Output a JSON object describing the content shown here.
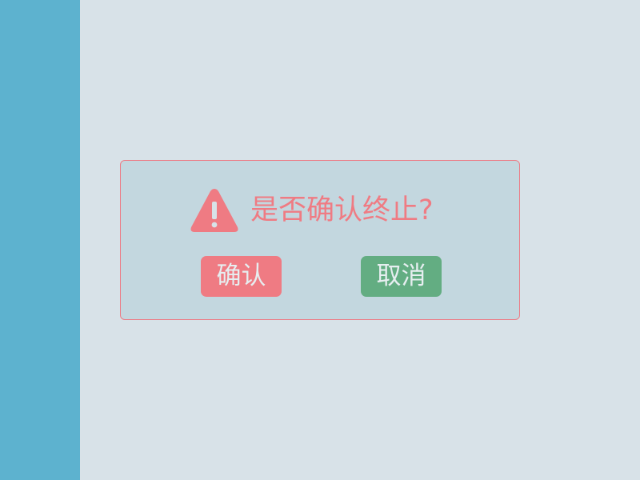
{
  "dialog": {
    "icon": "warning-triangle-icon",
    "message": "是否确认终止?",
    "confirm_label": "确认",
    "cancel_label": "取消"
  },
  "colors": {
    "sidebar": "#5db2cf",
    "background": "#d8e2e8",
    "dialog_background": "#c3d7df",
    "dialog_border": "#ec7c86",
    "warning": "#ef7b83",
    "confirm_button": "#ef7b83",
    "cancel_button": "#63ad82"
  }
}
